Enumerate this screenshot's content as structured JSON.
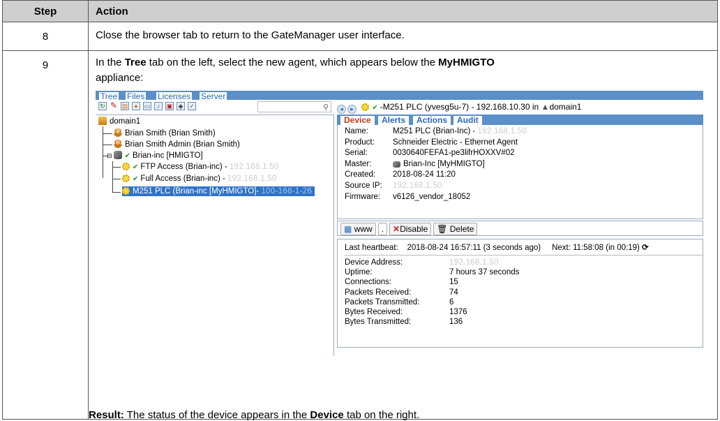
{
  "table": {
    "header_step": "Step",
    "header_action": "Action",
    "row8": {
      "step": "8",
      "action": "Close the browser tab to return to the GateManager user interface."
    },
    "row9": {
      "step": "9",
      "intro_a": "In the ",
      "intro_tree": "Tree",
      "intro_b": " tab on the left, select the new agent, which appears below the ",
      "intro_appliance": "MyHMIGTO",
      "intro_c": " appliance:",
      "result_label": "Result:",
      "result_a": " The status of the device appears in the ",
      "result_device": "Device",
      "result_b": " tab on the right."
    }
  },
  "app": {
    "tabs": [
      "Tree",
      "Files",
      "Licenses",
      "Server"
    ],
    "tree": {
      "domain": "domain1",
      "user1": "Brian Smith (Brian Smith)",
      "user2": "Brian Smith Admin (Brian Smith)",
      "appliance": "Brian-inc [HMIGTO]",
      "agent1": "FTP Access (Brian-inc) - ",
      "agent1_ip": "192.168.1.50",
      "agent2": "Full Access (Brian-inc) - ",
      "agent2_ip": "192.168.1.50",
      "agent3": "M251 PLC (Brian-inc [MyHMIGTO]- ",
      "agent3_ip": "100-168-1-26"
    },
    "nav_title": "-M251 PLC (yvesg5u-7) - 192.168.10.30 in",
    "nav_domain": "domain1",
    "right_tabs": [
      "Device",
      "Alerts",
      "Actions",
      "Audit"
    ],
    "info": {
      "name_k": "Name:",
      "name_v": "M251 PLC (Brian-Inc) - ",
      "name_ip": "192.168.1.50",
      "product_k": "Product:",
      "product_v": "Schneider Electric - Ethernet Agent",
      "serial_k": "Serial:",
      "serial_v": "0030640FEFA1-pe3lifrHOXXV#02",
      "master_k": "Master:",
      "master_v": "Brian-Inc [MyHMIGTO]",
      "created_k": "Created:",
      "created_v": "2018-08-24 11:20",
      "source_k": "Source IP:",
      "source_v": "192.168.1.50",
      "firmware_k": "Firmware:",
      "firmware_v": "v6126_vendor_18052"
    },
    "buttons": {
      "www": "www",
      "sep": ".",
      "disable": "Disable",
      "delete": "Delete"
    },
    "heartbeat": {
      "label": "Last heartbeat:",
      "value": "2018-08-24  16:57:11 (3 seconds ago)",
      "next": "Next: 11:58:08 (in 00:19)"
    },
    "stats": [
      {
        "k": "Device Address:",
        "v": "192.168.1.50",
        "blur": true
      },
      {
        "k": "Uptime:",
        "v": "7 hours 37 seconds"
      },
      {
        "k": "Connections:",
        "v": "15"
      },
      {
        "k": "Packets Received:",
        "v": "74"
      },
      {
        "k": "Packets Transmitted:",
        "v": "6"
      },
      {
        "k": "Bytes Received:",
        "v": "1376"
      },
      {
        "k": "Bytes Transmitted:",
        "v": "136"
      }
    ]
  }
}
